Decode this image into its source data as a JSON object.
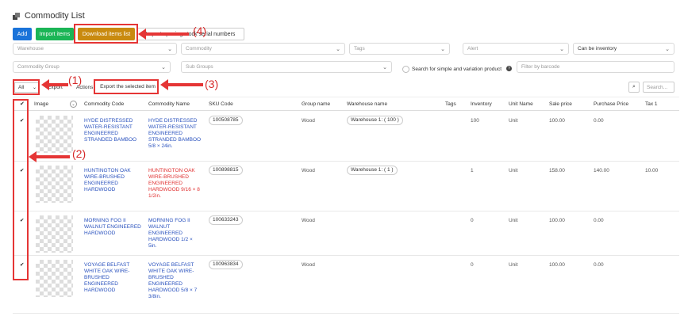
{
  "page": {
    "title": "Commodity List"
  },
  "toolbar": {
    "add": "Add",
    "import": "Import items",
    "download": "Download items list",
    "serial": "Import opening stock serial numbers"
  },
  "filters": {
    "warehouse": "Warehouse",
    "commodity": "Commodity",
    "tags": "Tags",
    "alert": "Alert",
    "can_be_inventory": "Can be inventory",
    "commodity_group": "Commodity Group",
    "sub_groups": "Sub Groups",
    "search_simple_variation": "Search for simple and variation product",
    "barcode_placeholder": "Filter by barcode"
  },
  "table_controls": {
    "select_value": "All",
    "export": "Export",
    "actions": "Actions",
    "export_selected": "Export the selected item",
    "search_placeholder": "Search..."
  },
  "annotations": {
    "a1": "(1)",
    "a2": "(2)",
    "a3": "(3)",
    "a4": "(4)"
  },
  "columns": [
    "Image",
    "Commodity Code",
    "Commodity Name",
    "SKU Code",
    "Group name",
    "Warehouse name",
    "Tags",
    "Inventory",
    "Unit Name",
    "Sale price",
    "Purchase Price",
    "Tax 1"
  ],
  "rows": [
    {
      "checked": "✔",
      "code_lines": [
        "HYDE DISTRESSED",
        "WATER-RESISTANT",
        "ENGINEERED",
        "STRANDED BAMBOO"
      ],
      "name_lines": [
        "HYDE DISTRESSED",
        "WATER-RESISTANT",
        "ENGINEERED",
        "STRANDED BAMBOO",
        "5/8 × 24in."
      ],
      "name_color": "blue",
      "sku": "100508785",
      "group": "Wood",
      "warehouse": "Warehouse 1: ( 100 )",
      "inventory": "100",
      "unit": "Unit",
      "sale": "100.00",
      "purchase": "0.00",
      "tax": ""
    },
    {
      "checked": "✔",
      "code_lines": [
        "HUNTINGTON OAK",
        "WIRE-BRUSHED",
        "ENGINEERED",
        "HARDWOOD"
      ],
      "name_lines": [
        "HUNTINGTON OAK",
        "WIRE-BRUSHED",
        "ENGINEERED",
        "HARDWOOD 9/16 × 8",
        "1/2in."
      ],
      "name_color": "red",
      "sku": "100898815",
      "group": "Wood",
      "warehouse": "Warehouse 1: ( 1 )",
      "inventory": "1",
      "unit": "Unit",
      "sale": "158.00",
      "purchase": "140.00",
      "tax": "10.00"
    },
    {
      "checked": "✔",
      "code_lines": [
        "MORNING FOG II",
        "WALNUT ENGINEERED",
        "HARDWOOD"
      ],
      "name_lines": [
        "MORNING FOG II",
        "WALNUT",
        "ENGINEERED",
        "HARDWOOD 1/2 ×",
        "5in."
      ],
      "name_color": "blue",
      "sku": "100633243",
      "group": "Wood",
      "warehouse": "",
      "inventory": "0",
      "unit": "Unit",
      "sale": "100.00",
      "purchase": "0.00",
      "tax": ""
    },
    {
      "checked": "✔",
      "code_lines": [
        "VOYAGE BELFAST",
        "WHITE OAK WIRE-",
        "BRUSHED ENGINEERED",
        "HARDWOOD"
      ],
      "name_lines": [
        "VOYAGE BELFAST",
        "WHITE OAK WIRE-",
        "BRUSHED",
        "ENGINEERED",
        "HARDWOOD 5/8 × 7",
        "3/8in."
      ],
      "name_color": "blue",
      "sku": "100963834",
      "group": "Wood",
      "warehouse": "",
      "inventory": "0",
      "unit": "Unit",
      "sale": "100.00",
      "purchase": "0.00",
      "tax": ""
    }
  ],
  "colors": {
    "add": "#1a73d9",
    "import": "#1bb556",
    "download": "#c98a0f",
    "annotation": "#e53535",
    "link": "#2a52be",
    "alert": "#e03030"
  }
}
